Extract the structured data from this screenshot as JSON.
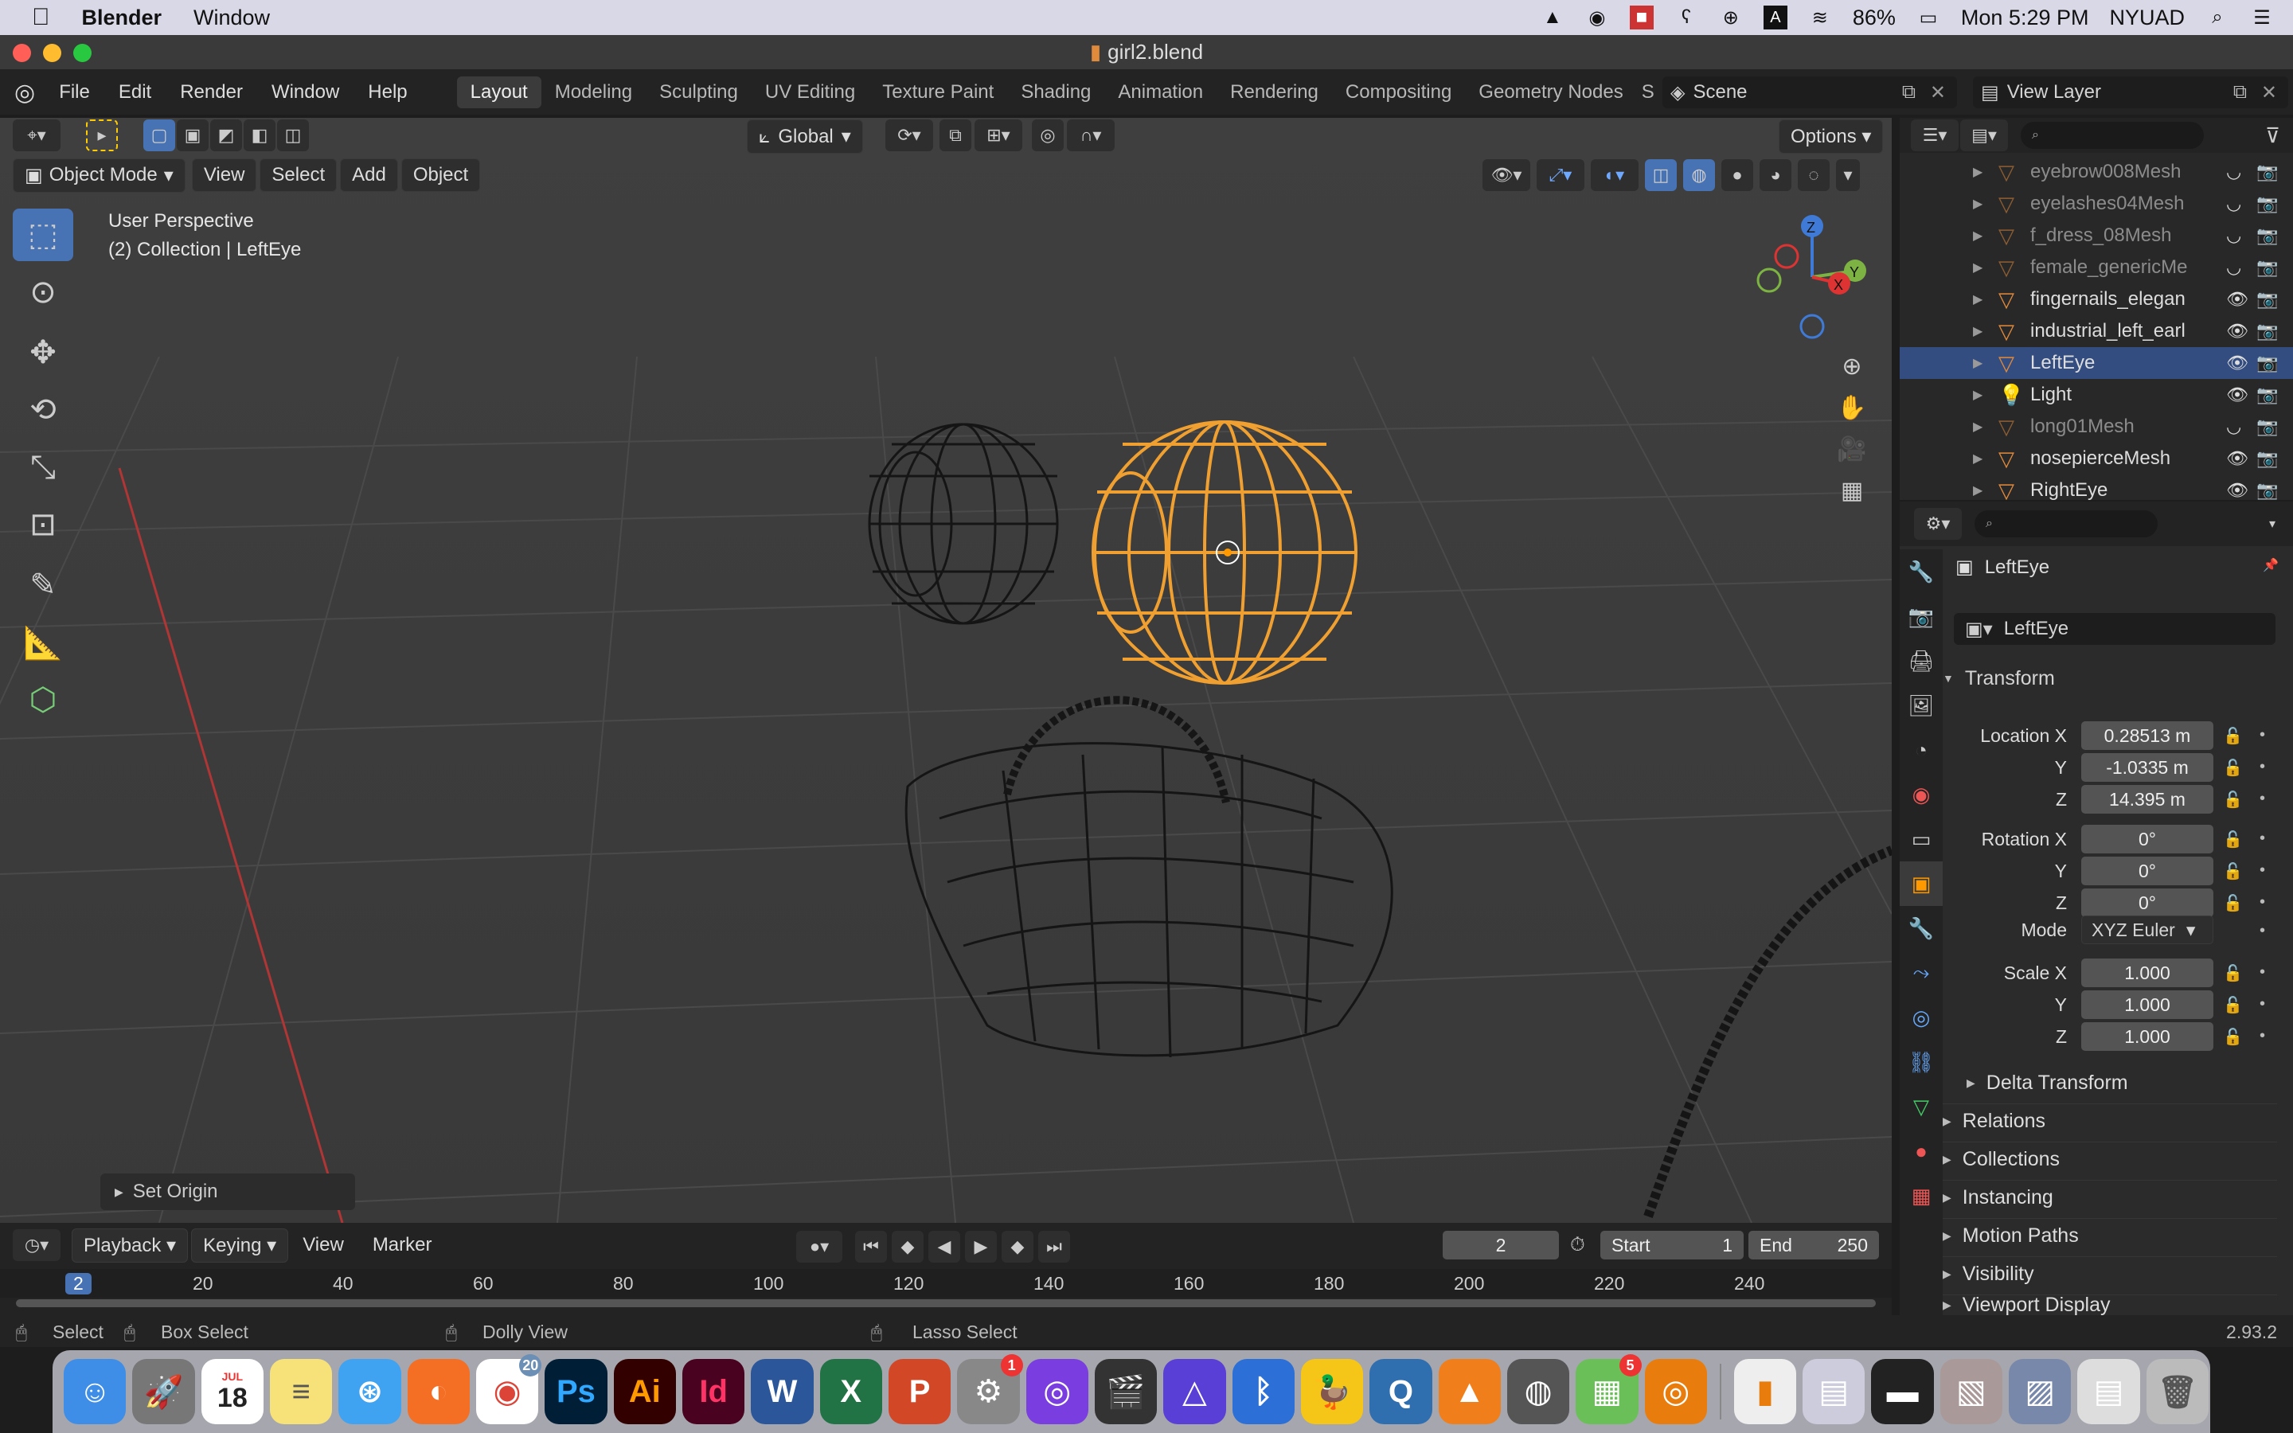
{
  "menubar": {
    "app": "Blender",
    "items": [
      "Window"
    ],
    "battery": "86%",
    "clock": "Mon 5:29 PM",
    "user": "NYUAD"
  },
  "window": {
    "title": "girl2.blend"
  },
  "topbar": {
    "menus": [
      "File",
      "Edit",
      "Render",
      "Window",
      "Help"
    ],
    "workspaces": [
      "Layout",
      "Modeling",
      "Sculpting",
      "UV Editing",
      "Texture Paint",
      "Shading",
      "Animation",
      "Rendering",
      "Compositing",
      "Geometry Nodes",
      "S"
    ],
    "scene": "Scene",
    "view_layer": "View Layer"
  },
  "viewport_header": {
    "transform_orientation": "Global",
    "options": "Options",
    "mode": "Object Mode",
    "menus": [
      "View",
      "Select",
      "Add",
      "Object"
    ]
  },
  "viewport": {
    "perspective": "User Perspective",
    "collection": "(2) Collection | LeftEye",
    "last_op": "Set Origin",
    "gizmo": {
      "z": "Z",
      "y": "Y",
      "x": "X"
    }
  },
  "outliner": {
    "rows": [
      {
        "name": "eyebrow008Mesh",
        "dim": true
      },
      {
        "name": "eyelashes04Mesh",
        "dim": true
      },
      {
        "name": "f_dress_08Mesh",
        "dim": true
      },
      {
        "name": "female_genericMe",
        "dim": true
      },
      {
        "name": "fingernails_elegan",
        "dim": false
      },
      {
        "name": "industrial_left_earl",
        "dim": false
      },
      {
        "name": "LeftEye",
        "dim": false,
        "selected": true
      },
      {
        "name": "Light",
        "dim": false
      },
      {
        "name": "long01Mesh",
        "dim": true
      },
      {
        "name": "nosepierceMesh",
        "dim": false
      },
      {
        "name": "RightEye",
        "dim": false
      }
    ]
  },
  "properties": {
    "object_name": "LeftEye",
    "data_name": "LeftEye",
    "transform_label": "Transform",
    "location_label": "Location X",
    "rotation_label": "Rotation X",
    "scale_label": "Scale X",
    "y": "Y",
    "z": "Z",
    "mode_label": "Mode",
    "mode": "XYZ Euler",
    "location": [
      "0.28513 m",
      "-1.0335 m",
      "14.395 m"
    ],
    "rotation": [
      "0°",
      "0°",
      "0°"
    ],
    "scale": [
      "1.000",
      "1.000",
      "1.000"
    ],
    "sections": [
      "Delta Transform",
      "Relations",
      "Collections",
      "Instancing",
      "Motion Paths",
      "Visibility",
      "Viewport Display"
    ]
  },
  "timeline": {
    "menus": [
      "Playback",
      "Keying",
      "View",
      "Marker"
    ],
    "current_frame": "2",
    "start_label": "Start",
    "start": "1",
    "end_label": "End",
    "end": "250",
    "ruler": [
      "2",
      "20",
      "40",
      "60",
      "80",
      "100",
      "120",
      "140",
      "160",
      "180",
      "200",
      "220",
      "240"
    ]
  },
  "status": {
    "select": "Select",
    "box_select": "Box Select",
    "dolly": "Dolly View",
    "lasso": "Lasso Select",
    "version": "2.93.2"
  },
  "dock": {
    "calendar_month": "JUL",
    "calendar_day": "18",
    "badge_chrome": "20",
    "badge_settings": "1",
    "badge_app": "5",
    "ps": "Ps",
    "ai": "Ai",
    "id": "Id"
  }
}
